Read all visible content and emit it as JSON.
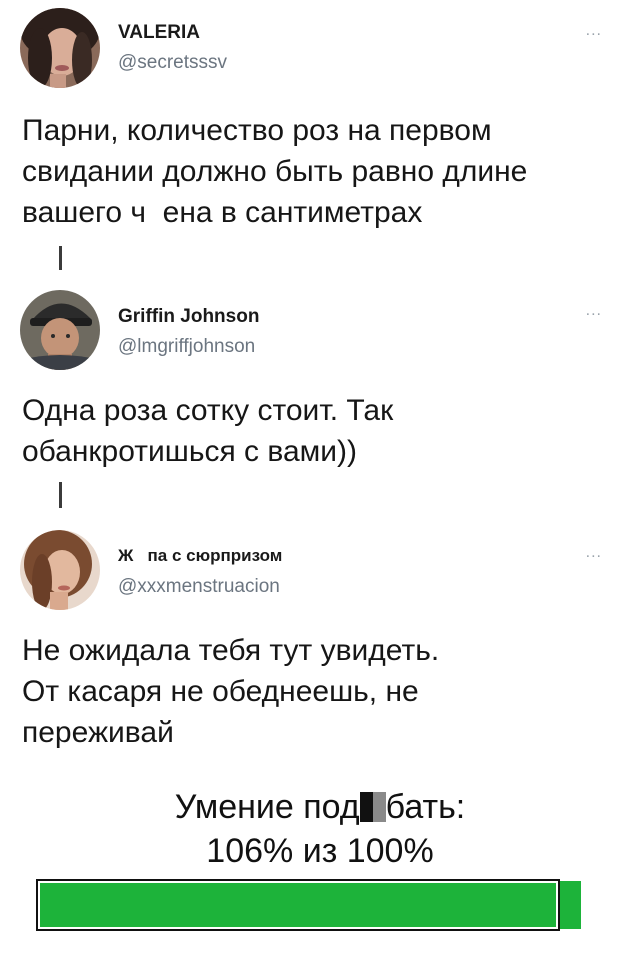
{
  "tweets": [
    {
      "name": "VALERIA",
      "handle": "@secretsssv",
      "more": "...",
      "text": "Парни, количество роз на первом свидании должно быть равно длине вашего ч  ена в сантиметрах",
      "lines": [
        "Парни, количество роз на первом",
        "свидании должно быть равно длине",
        "вашего ч  ена в сантиметрах"
      ]
    },
    {
      "name": "Griffin Johnson",
      "handle": "@lmgriffjohnson",
      "more": "...",
      "text": "Одна роза сотку стоит. Так обанкротишься с вами))",
      "lines": [
        "Одна роза сотку стоит. Так",
        "обанкротишься с вами))"
      ]
    },
    {
      "name": "Ж   па с сюрпризом",
      "handle": "@xxxmenstruacion",
      "more": "...",
      "text": "Не ожидала тебя тут увидеть. От касаря не обеднеешь, не переживай",
      "lines": [
        "Не ожидала тебя тут увидеть.",
        "От касаря не обеднеешь, не",
        "переживай"
      ]
    }
  ],
  "meme": {
    "caption_before": "Умение под",
    "caption_after": "бать:",
    "subcaption": "106% из 100%",
    "progress_percent": 106,
    "progress_max": 100,
    "bar_color": "#1db33a"
  },
  "colors": {
    "text": "#161616",
    "handle": "#6b7580",
    "thread_line": "#3b3b3b"
  }
}
